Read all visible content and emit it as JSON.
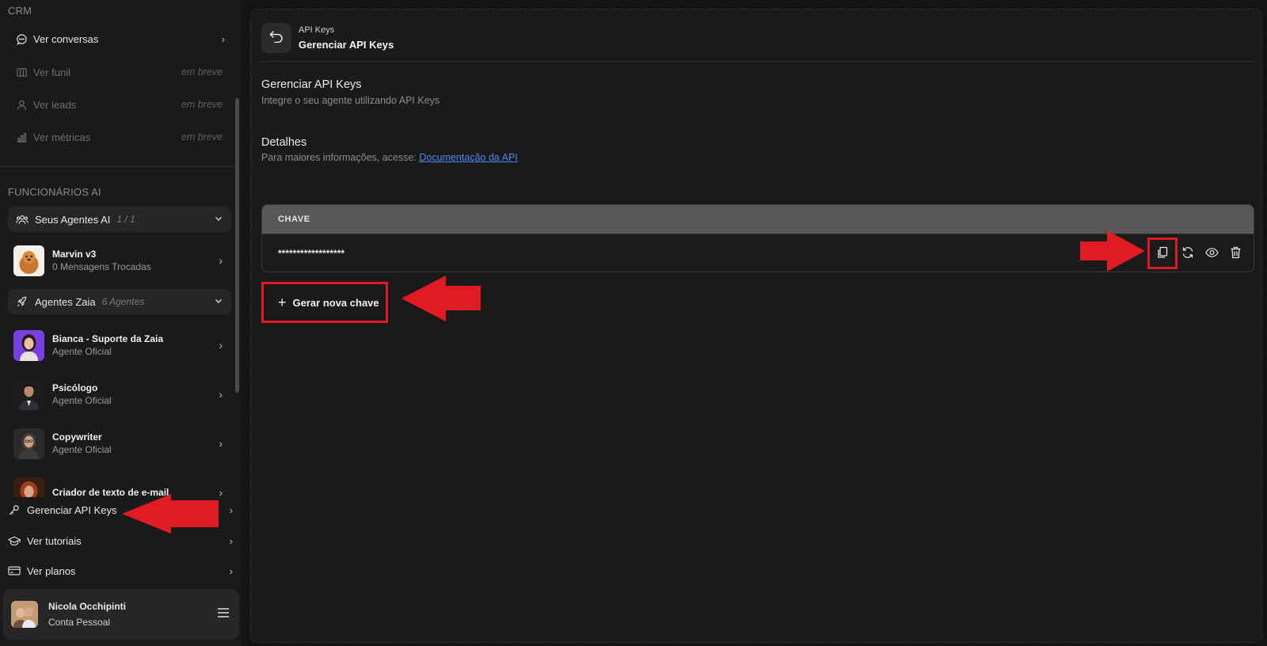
{
  "sidebar": {
    "crm_title": "CRM",
    "crm_items": [
      {
        "label": "Ver conversas",
        "enabled": true
      },
      {
        "label": "Ver funil",
        "badge": "em breve",
        "enabled": false
      },
      {
        "label": "Ver leads",
        "badge": "em breve",
        "enabled": false
      },
      {
        "label": "Ver métricas",
        "badge": "em breve",
        "enabled": false
      }
    ],
    "ai_title": "FUNCIONÁRIOS AI",
    "your_agents": {
      "label": "Seus Agentes AI",
      "count": "1 / 1"
    },
    "marvin": {
      "name": "Marvin v3",
      "sub": "0 Mensagens Trocadas"
    },
    "zaia_agents": {
      "label": "Agentes Zaia",
      "count": "6 Agentes"
    },
    "zaia_list": [
      {
        "name": "Bianca - Suporte da Zaia",
        "sub": "Agente Oficial"
      },
      {
        "name": "Psicólogo",
        "sub": "Agente Oficial"
      },
      {
        "name": "Copywriter",
        "sub": "Agente Oficial"
      },
      {
        "name": "Criador de texto de e-mail",
        "sub": ""
      }
    ],
    "bottom_nav": [
      {
        "label": "Gerenciar API Keys"
      },
      {
        "label": "Ver tutoriais"
      },
      {
        "label": "Ver planos"
      }
    ],
    "user": {
      "name": "Nicola Occhipinti",
      "sub": "Conta Pessoal"
    }
  },
  "main": {
    "crumb_small": "API Keys",
    "crumb_title": "Gerenciar API Keys",
    "section_title": "Gerenciar API Keys",
    "section_desc": "Integre o seu agente utilizando API Keys",
    "details_title": "Detalhes",
    "details_desc": "Para maiores informações, acesse: ",
    "doc_link": "Documentação da API",
    "table_header": "CHAVE",
    "masked_key": "******************",
    "generate_label": "Gerar nova chave"
  },
  "colors": {
    "highlight": "#e01b24",
    "link": "#4a8cf0",
    "bg": "#1a1a1a"
  }
}
